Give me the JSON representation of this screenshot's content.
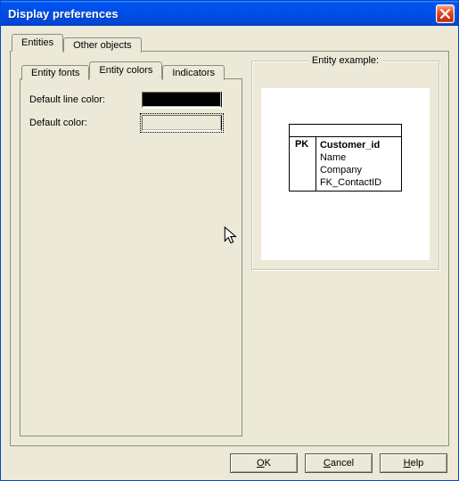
{
  "window": {
    "title": "Display preferences"
  },
  "tabs": {
    "main": [
      {
        "label": "Entities",
        "active": true
      },
      {
        "label": "Other objects",
        "active": false
      }
    ],
    "sub": [
      {
        "label": "Entity fonts",
        "active": false
      },
      {
        "label": "Entity colors",
        "active": true
      },
      {
        "label": "Indicators",
        "active": false
      }
    ]
  },
  "form": {
    "line_color_label": "Default line color:",
    "line_color_value": "#000000",
    "default_color_label": "Default color:",
    "default_color_value": "#ece9d8"
  },
  "example": {
    "legend": "Entity example:",
    "pk_label": "PK",
    "fields": [
      "Customer_id",
      "Name",
      "Company",
      "FK_ContactID"
    ]
  },
  "buttons": {
    "ok": "OK",
    "cancel": "Cancel",
    "help": "Help"
  }
}
